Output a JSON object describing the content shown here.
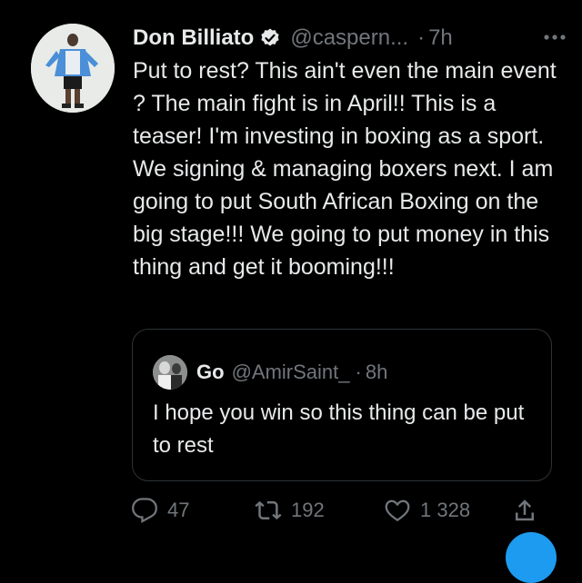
{
  "tweet": {
    "author_name": "Don Billiato",
    "handle": "@caspern...",
    "separator": "·",
    "time": "7h",
    "text": "Put to rest? This ain't even the main event ? The main fight is in April!! This is a teaser! I'm investing in boxing as a sport. We signing & managing boxers next. I am going to put South African Boxing on the big stage!!! We going to put money in this thing and get it booming!!!"
  },
  "quoted": {
    "author_name": "Go",
    "handle": "@AmirSaint_",
    "separator": "·",
    "time": "8h",
    "text": "I hope you win so this thing can be put to rest"
  },
  "actions": {
    "replies": "47",
    "retweets": "192",
    "likes": "1 328"
  },
  "colors": {
    "background": "#000000",
    "primary_text": "#e7e9ea",
    "secondary_text": "#71767b",
    "accent": "#1d9bf0"
  },
  "icons": [
    "verified-badge-icon",
    "more-icon",
    "reply-icon",
    "retweet-icon",
    "like-icon",
    "share-icon"
  ]
}
